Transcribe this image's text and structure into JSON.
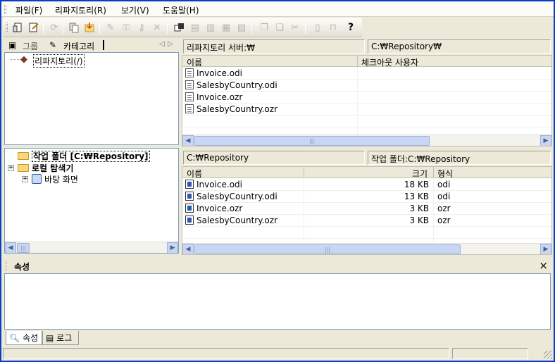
{
  "menubar": {
    "items": [
      "파일(F)",
      "리파지토리(R)",
      "보기(V)",
      "도움말(H)"
    ]
  },
  "toolbar": {
    "icons": [
      "open-icon",
      "checkout-icon",
      "refresh-icon",
      "copy-icon",
      "import-icon",
      "link-icon",
      "lock-icon",
      "unlock-icon",
      "delete-icon",
      "new-folder-icon",
      "upload-icon",
      "download-icon",
      "export-icon",
      "clone-icon",
      "group-icon",
      "properties-icon",
      "doc-icon",
      "key-icon",
      "help-icon"
    ]
  },
  "left_top": {
    "tab_group": "그룹",
    "tab_category": "카테고리",
    "tree_root": "리파지토리(/)"
  },
  "repo_panel": {
    "server_label": "리파지토리 서버:₩",
    "path": "C:₩Repository₩",
    "col_name": "이름",
    "col_checkout": "체크아웃 사용자",
    "files": [
      {
        "name": "Invoice.odi",
        "user": ""
      },
      {
        "name": "SalesbyCountry.odi",
        "user": ""
      },
      {
        "name": "Invoice.ozr",
        "user": ""
      },
      {
        "name": "SalesbyCountry.ozr",
        "user": ""
      }
    ]
  },
  "left_bottom": {
    "work_folder": "작업 폴더 [C:₩Repository]",
    "local_explorer": "로컬 탐색기",
    "desktop": "바탕 화면"
  },
  "local_panel": {
    "path": "C:₩Repository",
    "work_folder_label": "작업 폴더:C:₩Repository",
    "col_name": "이름",
    "col_size": "크기",
    "col_type": "형식",
    "files": [
      {
        "name": "Invoice.odi",
        "size": "18 KB",
        "type": "odi"
      },
      {
        "name": "SalesbyCountry.odi",
        "size": "13 KB",
        "type": "odi"
      },
      {
        "name": "Invoice.ozr",
        "size": "3 KB",
        "type": "ozr"
      },
      {
        "name": "SalesbyCountry.ozr",
        "size": "3 KB",
        "type": "ozr"
      }
    ]
  },
  "properties": {
    "title": "속성",
    "close": "×"
  },
  "bottom_tabs": {
    "properties": "속성",
    "log": "로그"
  },
  "colors": {
    "accent": "#0a3cc8",
    "panel_bg": "#ece9d8"
  }
}
